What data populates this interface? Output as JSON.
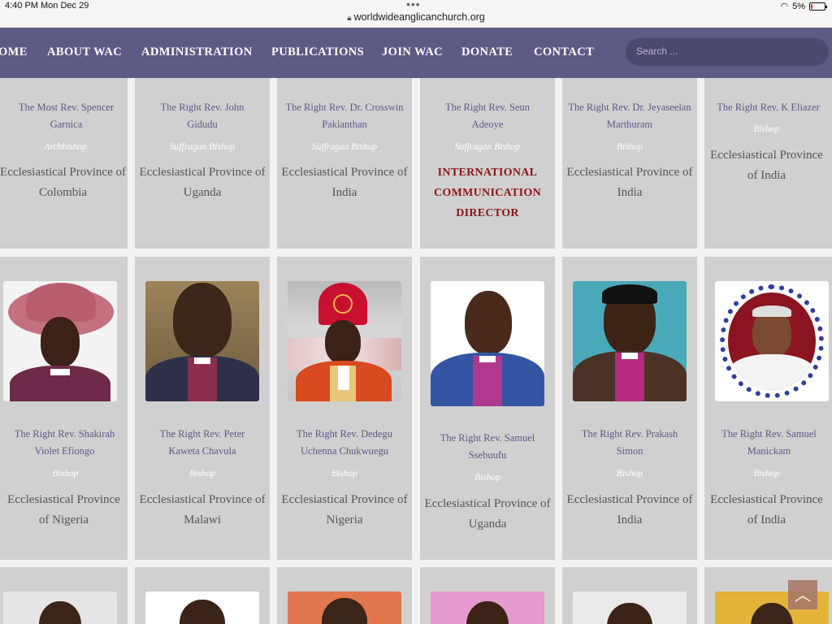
{
  "status_bar": {
    "time": "4:40 PM",
    "date": "Mon Dec 29",
    "url": "worldwideanglicanchurch.org",
    "battery": "5%"
  },
  "nav": {
    "items": [
      "OME",
      "ABOUT WAC",
      "ADMINISTRATION",
      "PUBLICATIONS",
      "JOIN WAC",
      "DONATE",
      "CONTACT"
    ],
    "search_placeholder": "Search ..."
  },
  "row1": [
    {
      "name": "The Most Rev. Spencer Garnica",
      "role": "Archbishop",
      "province": "Ecclesiastical Province of Colombia"
    },
    {
      "name": "The Right Rev. John Gidudu",
      "role": "Suffragan Bishop",
      "province": "Ecclesiastical Province of Uganda"
    },
    {
      "name": "The Right Rev. Dr. Crosswin Pakianthan",
      "role": "Suffragan Bishop",
      "province": "Ecclesiastical Province of India"
    },
    {
      "name": "The Right Rev. Seun Adeoye",
      "role": "Suffragan Bishop",
      "province": "INTERNATIONAL COMMUNICATION DIRECTOR"
    },
    {
      "name": "The Right Rev. Dr. Jeyaseelan Marthuram",
      "role": "Bishop",
      "province": "Ecclesiastical Province of India"
    },
    {
      "name": "The Right Rev. K Eliazer",
      "role": "Bishop",
      "province": "Ecclesiastical Province of India"
    }
  ],
  "row2": [
    {
      "name": "The Right Rev. Shakirah Violet Efiongo",
      "role": "Bishop",
      "province": "Ecclesiastical Province of Nigeria"
    },
    {
      "name": "The Right Rev. Peter Kaweta Chavula",
      "role": "Bishop",
      "province": "Ecclesiastical Province of Malawi"
    },
    {
      "name": "The Right Rev. Dedegu Uchenna Chukwuegu",
      "role": "Bishop",
      "province": "Ecclesiastical Province of Nigeria"
    },
    {
      "name": "The Right Rev. Samuel Ssebuufu",
      "role": "Bishop",
      "province": "Ecclesiastical Province of  Uganda"
    },
    {
      "name": "The Right Rev. Prakash Simon",
      "role": "Bishop",
      "province": "Ecclesiastical Province of India"
    },
    {
      "name": "The Right Rev. Samuel Manickam",
      "role": "Bishop",
      "province": "Ecclesiastical Province of India"
    }
  ],
  "back_to_top_icon": "chevron-up-icon"
}
